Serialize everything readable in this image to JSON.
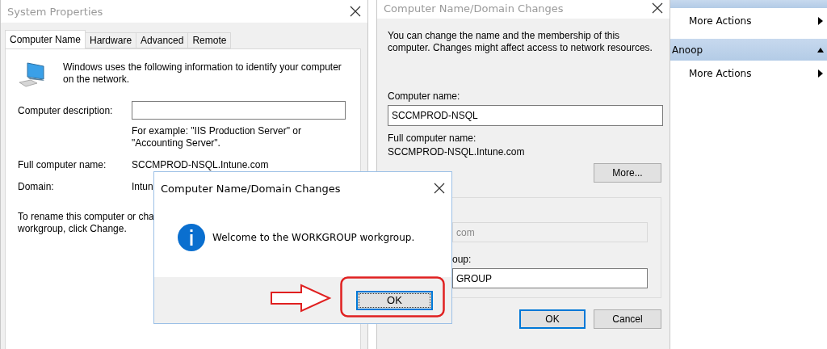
{
  "system_properties": {
    "title": "System Properties",
    "tabs": [
      {
        "label": "Computer Name",
        "selected": true
      },
      {
        "label": "Hardware",
        "selected": false
      },
      {
        "label": "Advanced",
        "selected": false
      },
      {
        "label": "Remote",
        "selected": false
      }
    ],
    "intro": "Windows uses the following information to identify your computer on the network.",
    "description_label": "Computer description:",
    "example": "For example: \"IIS Production Server\" or \"Accounting Server\".",
    "full_name_label": "Full computer name:",
    "full_name_value": "SCCMPROD-NSQL.Intune.com",
    "domain_label": "Domain:",
    "domain_value": "Intun",
    "rename_lines": [
      "To rename this computer or cha",
      "workgroup, click Change."
    ]
  },
  "changes_dialog": {
    "title": "Computer Name/Domain Changes",
    "intro_lines": [
      "You can change the name and the membership of this",
      "computer. Changes might affect access to network resources."
    ],
    "computer_name_label": "Computer name:",
    "computer_name_value": "SCCMPROD-NSQL",
    "full_name_label": "Full computer name:",
    "full_name_value": "SCCMPROD-NSQL.Intune.com",
    "more_button": "More...",
    "domain_value": "com",
    "workgroup_label": "oup:",
    "workgroup_value": "GROUP",
    "buttons": [
      {
        "label": "OK",
        "default": true
      },
      {
        "label": "Cancel",
        "default": false
      }
    ]
  },
  "actions_pane": {
    "items": [
      {
        "kind": "action",
        "label": "More Actions"
      },
      {
        "kind": "header",
        "label": "Anoop"
      },
      {
        "kind": "action",
        "label": "More Actions"
      }
    ]
  },
  "message_box": {
    "title": "Computer Name/Domain Changes",
    "message": "Welcome to the WORKGROUP workgroup.",
    "button": "OK"
  }
}
